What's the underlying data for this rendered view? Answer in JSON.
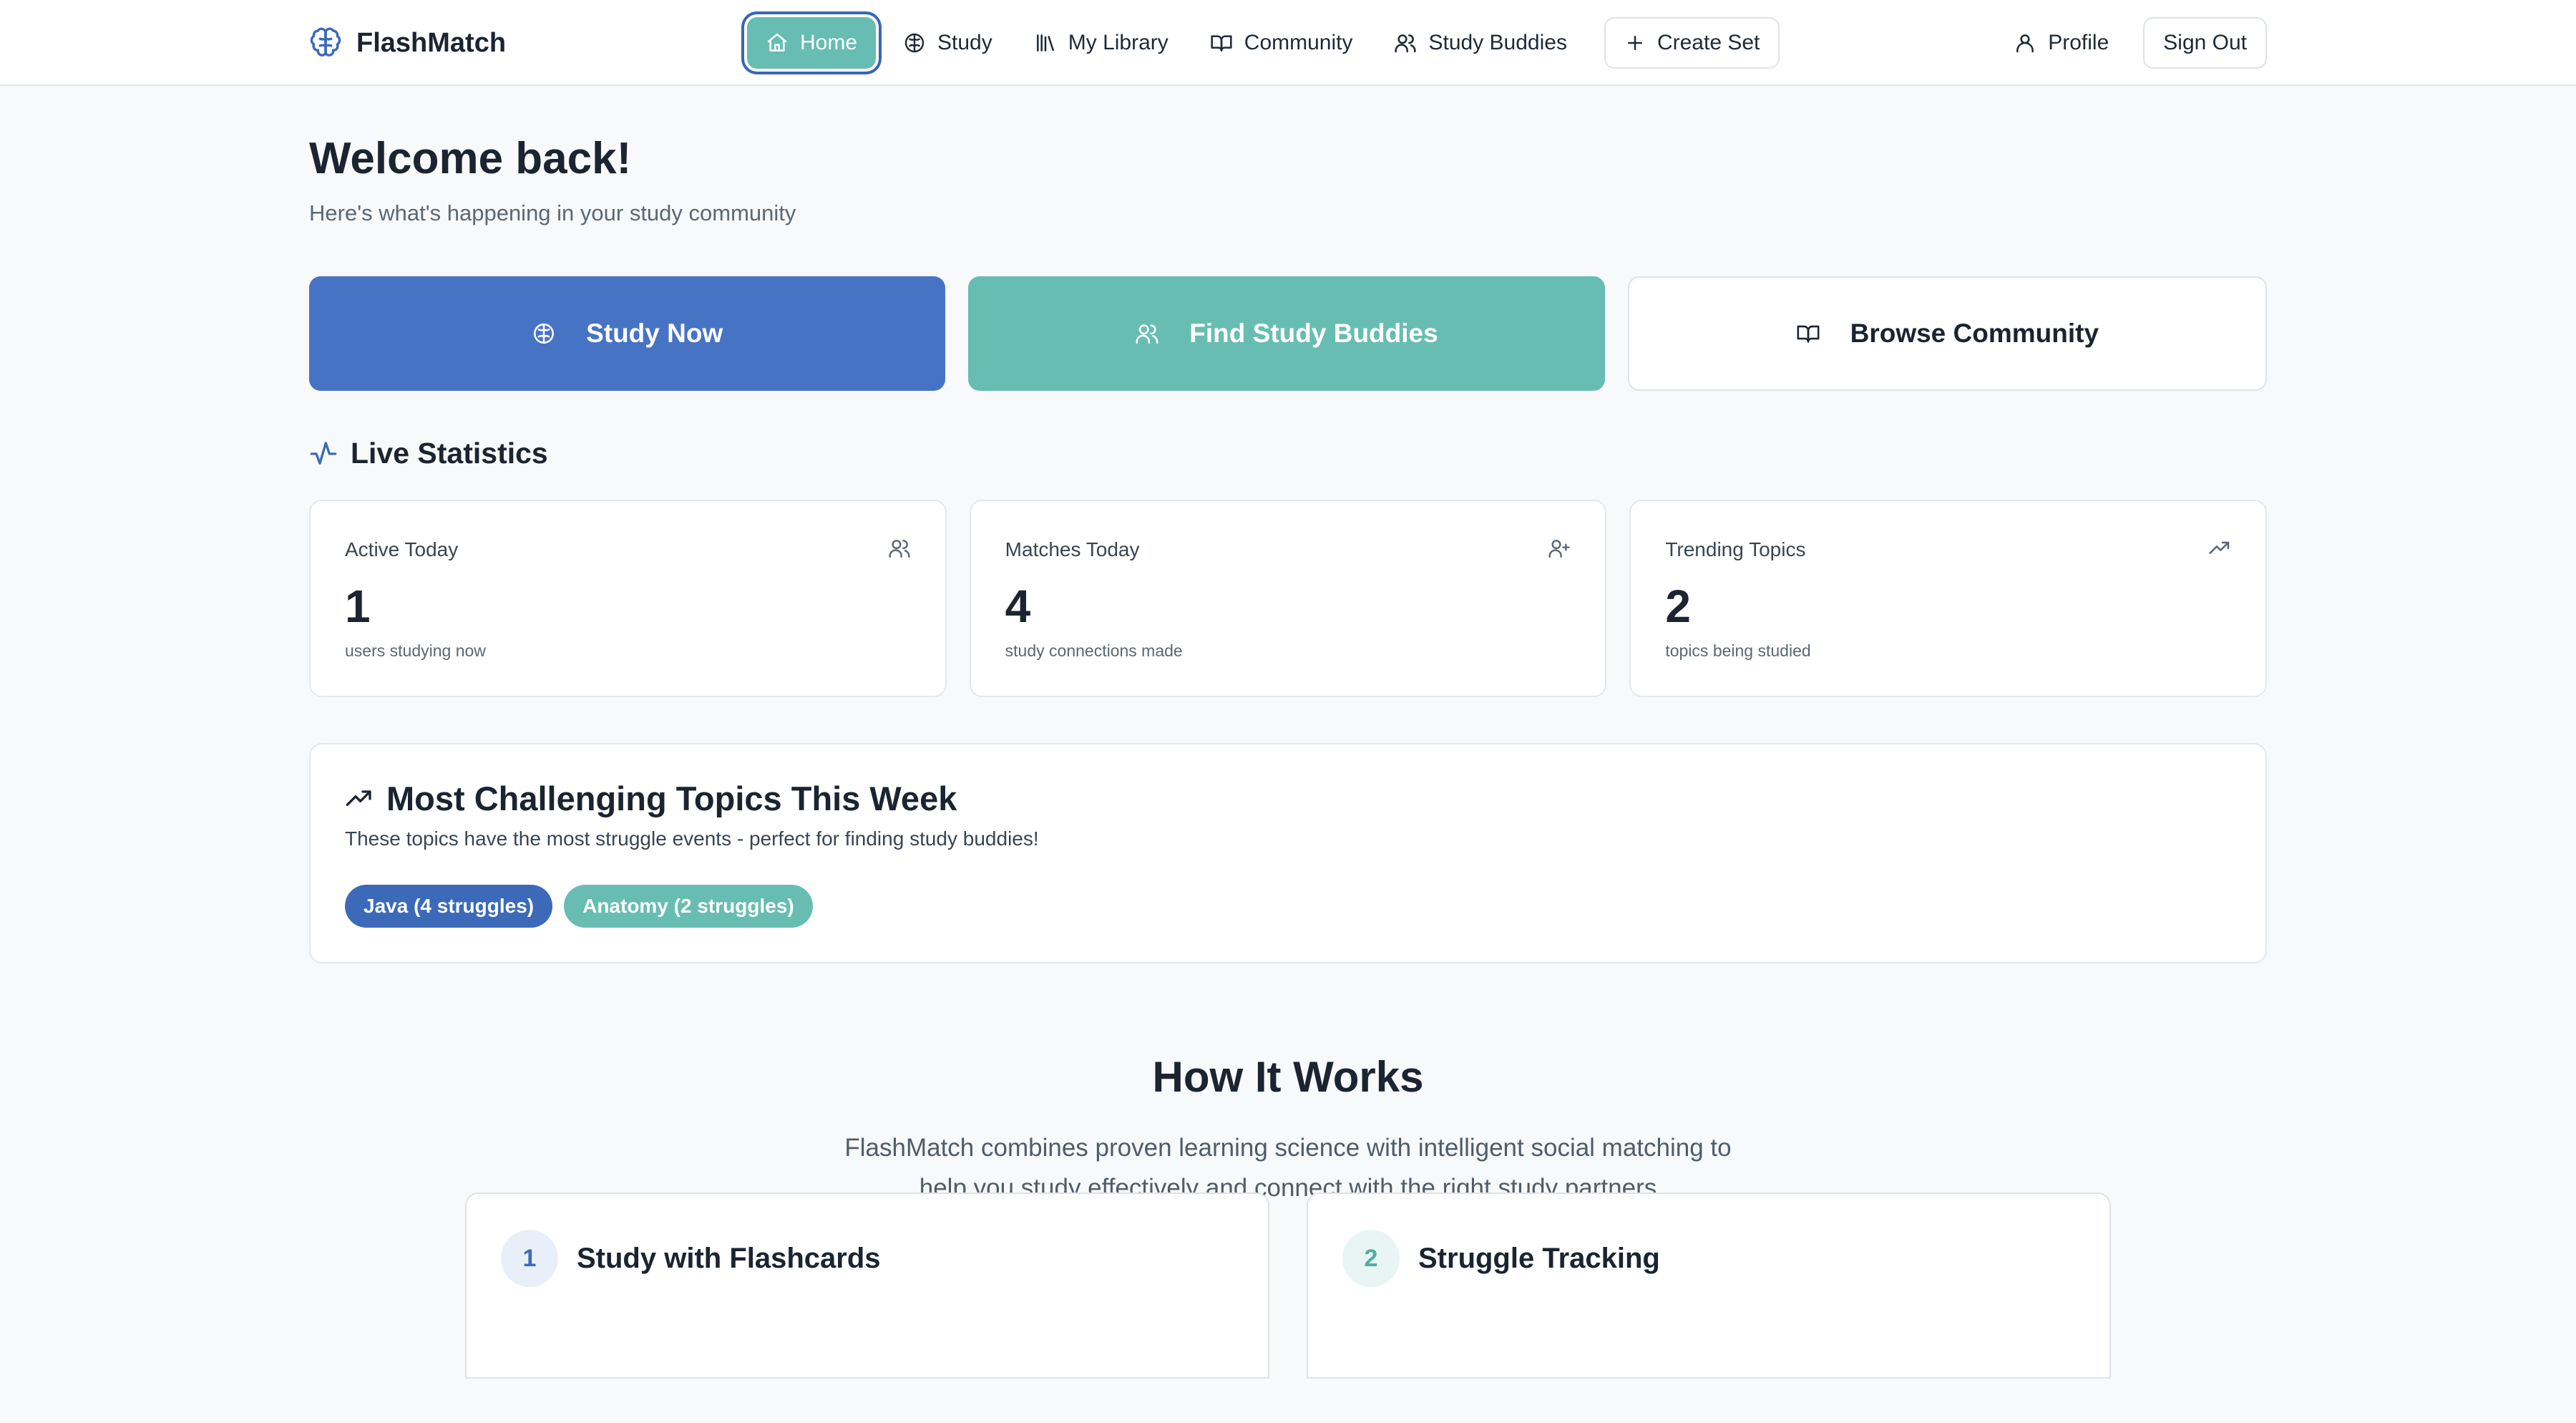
{
  "brand": {
    "name": "FlashMatch",
    "icon": "brain-icon",
    "color": "#3c6ab8"
  },
  "nav": {
    "home": "Home",
    "study": "Study",
    "library": "My Library",
    "community": "Community",
    "buddies": "Study Buddies",
    "create": "Create Set",
    "profile": "Profile",
    "signout": "Sign Out"
  },
  "welcome": {
    "title": "Welcome back!",
    "subtitle": "Here's what's happening in your study community"
  },
  "actions": {
    "study_now": "Study Now",
    "find_buddies": "Find Study Buddies",
    "browse": "Browse Community"
  },
  "live_stats": {
    "title": "Live Statistics",
    "items": [
      {
        "label": "Active Today",
        "value": "1",
        "note": "users studying now",
        "icon": "users-icon"
      },
      {
        "label": "Matches Today",
        "value": "4",
        "note": "study connections made",
        "icon": "user-plus-icon"
      },
      {
        "label": "Trending Topics",
        "value": "2",
        "note": "topics being studied",
        "icon": "trending-up-icon"
      }
    ]
  },
  "challenging": {
    "title": "Most Challenging Topics This Week",
    "subtitle": "These topics have the most struggle events - perfect for finding study buddies!",
    "topics": [
      {
        "label": "Java (4 struggles)",
        "color": "#3c6ab8"
      },
      {
        "label": "Anatomy (2 struggles)",
        "color": "#68bdb2"
      }
    ]
  },
  "how": {
    "title": "How It Works",
    "subtitle": "FlashMatch combines proven learning science with intelligent social matching to help you study effectively and connect with the right study partners",
    "steps": [
      {
        "num": "1",
        "title": "Study with Flashcards"
      },
      {
        "num": "2",
        "title": "Struggle Tracking"
      }
    ]
  },
  "colors": {
    "primary": "#4773c4",
    "teal": "#68bdb2",
    "text": "#1b2430",
    "muted": "#5a6775"
  }
}
